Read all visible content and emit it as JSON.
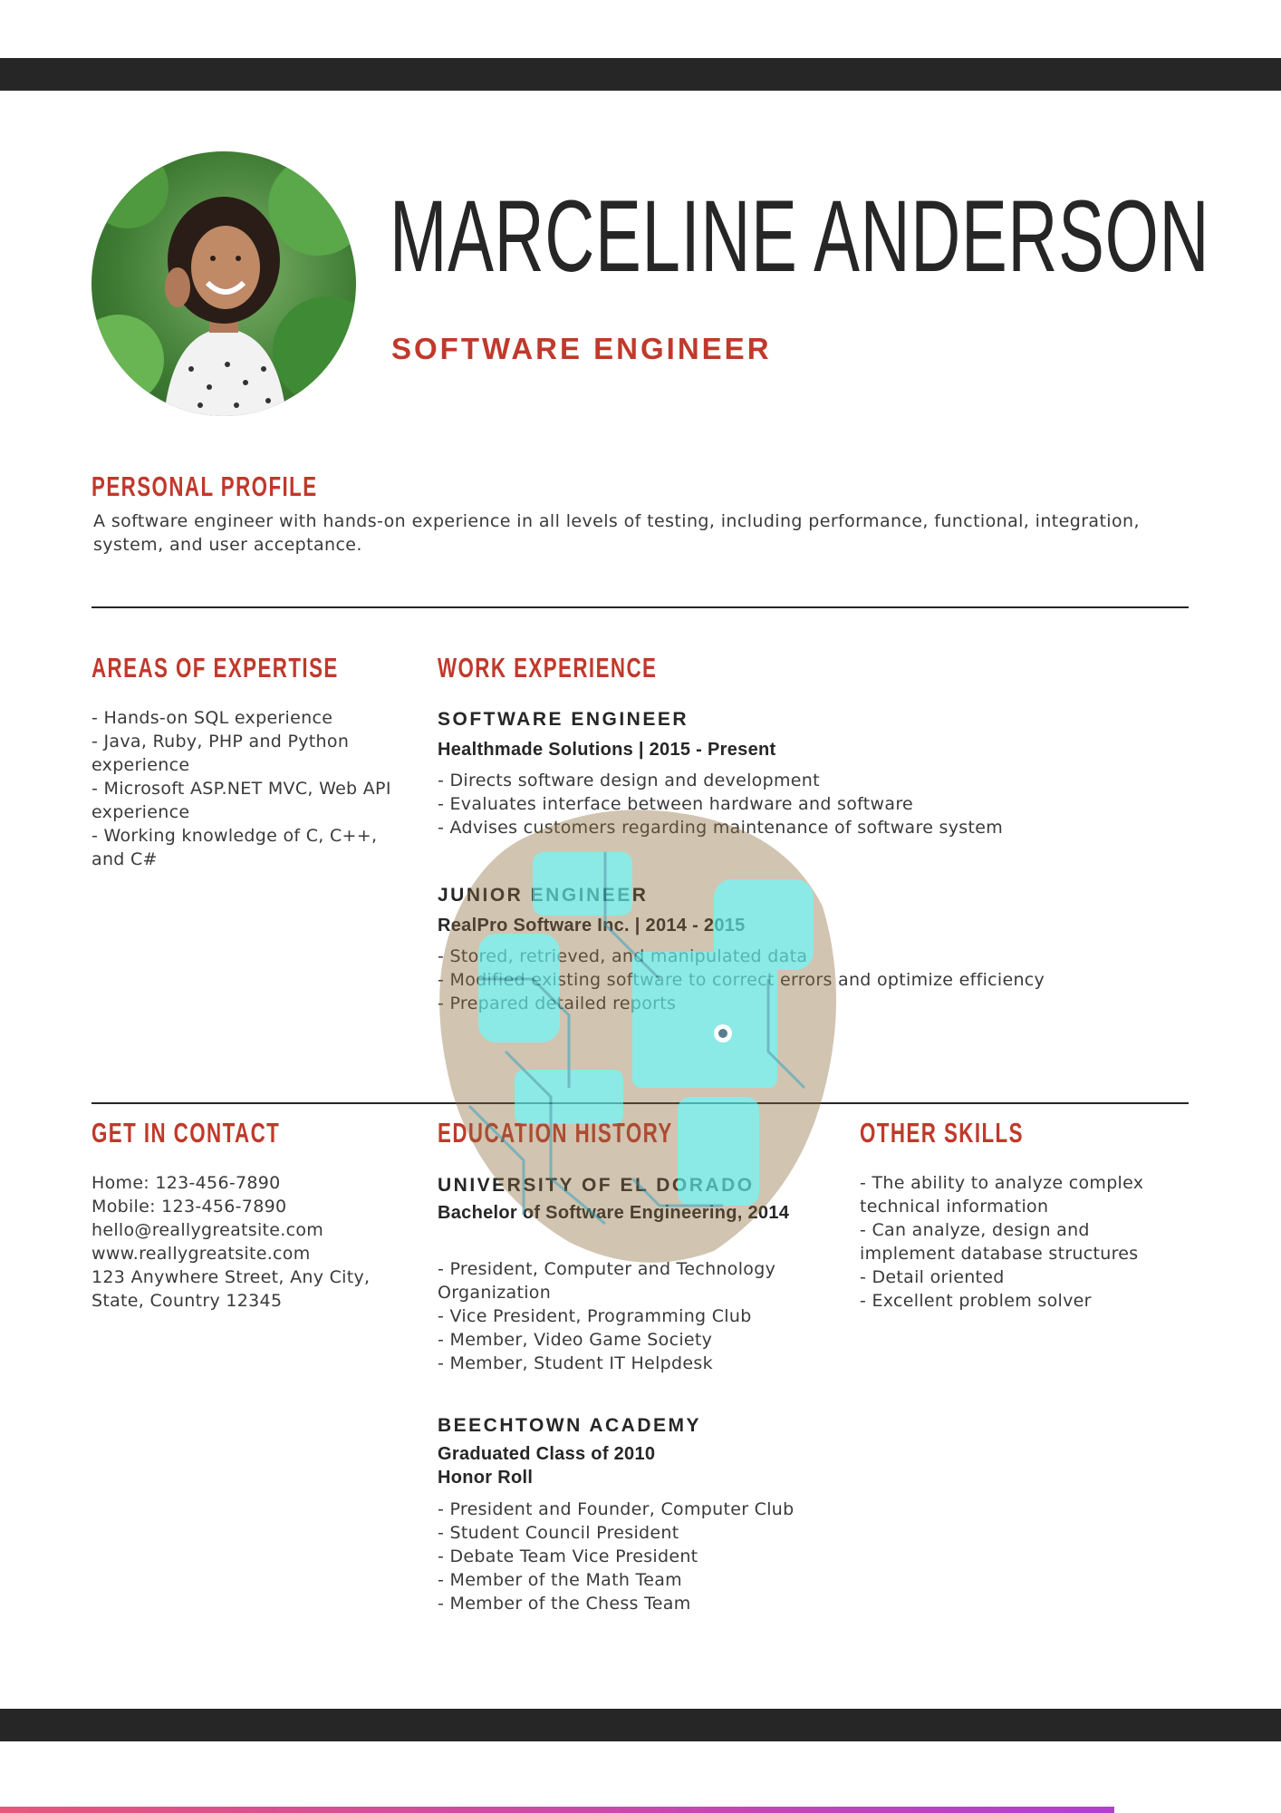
{
  "header": {
    "name": "MARCELINE ANDERSON",
    "role": "SOFTWARE ENGINEER"
  },
  "profile": {
    "title": "PERSONAL PROFILE",
    "text": "A software engineer with hands-on experience in all levels of testing, including performance, functional, integration, system, and user acceptance."
  },
  "expertise": {
    "title": "AREAS OF EXPERTISE",
    "items": [
      "- Hands-on SQL experience",
      "- Java, Ruby, PHP and Python",
      "experience",
      "- Microsoft ASP.NET MVC, Web API",
      "experience",
      "- Working knowledge of C, C++,",
      "and C#"
    ]
  },
  "work": {
    "title": "WORK EXPERIENCE",
    "jobs": [
      {
        "title": "SOFTWARE ENGINEER",
        "company": "Healthmade Solutions | 2015 - Present",
        "duties": [
          "- Directs software design and development",
          "- Evaluates interface between hardware and software",
          "- Advises customers regarding maintenance of software system"
        ]
      },
      {
        "title": "JUNIOR ENGINEER",
        "company": "RealPro Software Inc. | 2014 - 2015",
        "duties": [
          "- Stored, retrieved, and manipulated data",
          "- Modified existing software to correct errors and optimize efficiency",
          "- Prepared detailed reports"
        ]
      }
    ]
  },
  "contact": {
    "title": "GET IN CONTACT",
    "lines": [
      "Home: 123-456-7890",
      "Mobile: 123-456-7890",
      "hello@reallygreatsite.com",
      "www.reallygreatsite.com",
      "123 Anywhere Street, Any City,",
      "State, Country 12345"
    ]
  },
  "education": {
    "title": "EDUCATION HISTORY",
    "schools": [
      {
        "name": "UNIVERSITY OF EL DORADO",
        "details": [
          "Bachelor of Software Engineering, 2014"
        ],
        "activities": [
          "- President, Computer and Technology",
          "Organization",
          "- Vice President, Programming Club",
          "- Member, Video Game Society",
          "- Member, Student IT Helpdesk"
        ]
      },
      {
        "name": "BEECHTOWN ACADEMY",
        "details": [
          "Graduated Class of 2010",
          "Honor Roll"
        ],
        "activities": [
          "- President and Founder, Computer Club",
          "- Student Council President",
          "- Debate Team Vice President",
          "- Member of the Math Team",
          "- Member of the Chess Team"
        ]
      }
    ]
  },
  "skills": {
    "title": "OTHER SKILLS",
    "items": [
      "- The ability to analyze complex",
      "technical information",
      "- Can analyze, design and",
      "implement database structures",
      "- Detail oriented",
      "- Excellent problem solver"
    ]
  },
  "colors": {
    "accent": "#c0392b",
    "dark": "#262626",
    "overlay_cyan": "#5fe3dc"
  }
}
